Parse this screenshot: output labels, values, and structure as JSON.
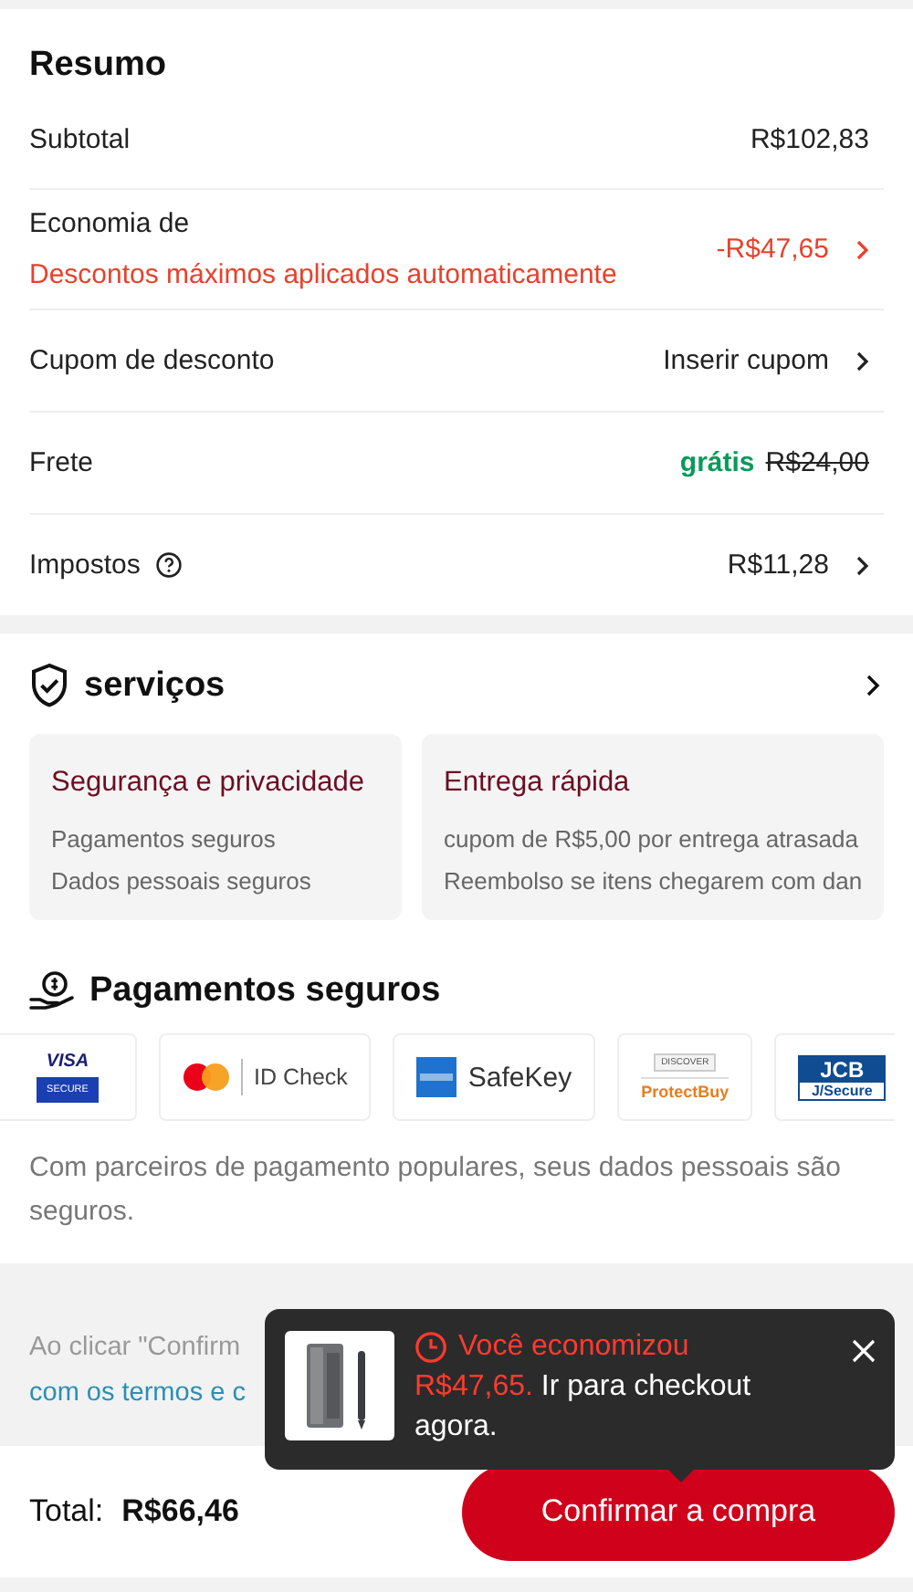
{
  "summary": {
    "title": "Resumo",
    "rows": [
      {
        "kind": "plain",
        "label": "Subtotal",
        "value": "R$102,83",
        "chevron": false,
        "help": false
      },
      {
        "kind": "savings",
        "label": "Economia de",
        "note": "Descontos máximos aplicados automaticamente",
        "value": "-R$47,65",
        "chevron": true,
        "help": false
      },
      {
        "kind": "plain",
        "label": "Cupom de desconto",
        "value": "Inserir cupom",
        "chevron": true,
        "help": false
      },
      {
        "kind": "shipping",
        "label": "Frete",
        "free": "grátis",
        "value": "R$24,00",
        "chevron": false,
        "help": false
      },
      {
        "kind": "plain",
        "label": "Impostos",
        "value": "R$11,28",
        "chevron": true,
        "help": true
      }
    ]
  },
  "services": {
    "title": "serviços",
    "cards": [
      {
        "title": "Segurança e privacidade",
        "lines": [
          "Pagamentos seguros",
          "Dados pessoais seguros"
        ]
      },
      {
        "title": "Entrega rápida",
        "lines": [
          "cupom de R$5,00 por entrega atrasada",
          "Reembolso se itens chegarem com dan"
        ]
      }
    ]
  },
  "payments": {
    "title": "Pagamentos seguros",
    "partners": [
      {
        "kind": "visa",
        "texts": [
          "VISA",
          "SECURE"
        ]
      },
      {
        "kind": "mastercard",
        "texts": [
          "ID Check"
        ]
      },
      {
        "kind": "amex",
        "texts": [
          "SafeKey"
        ]
      },
      {
        "kind": "discover",
        "texts": [
          "DISCOVER",
          "ProtectBuy"
        ]
      },
      {
        "kind": "jcb",
        "texts": [
          "JCB",
          "J/Secure"
        ]
      }
    ],
    "note": "Com parceiros de pagamento populares, seus dados pessoais são seguros."
  },
  "legal": {
    "lines": [
      {
        "kind": "plain",
        "text": "Ao clicar \"Confirm"
      },
      {
        "kind": "link",
        "text": "com os termos e c"
      }
    ]
  },
  "toast": {
    "title": "Você economizou",
    "amount": "R$47,65.",
    "text": "Ir para checkout agora."
  },
  "footer": {
    "total_label": "Total:",
    "total_value": "R$66,46",
    "button": "Confirmar a compra"
  }
}
